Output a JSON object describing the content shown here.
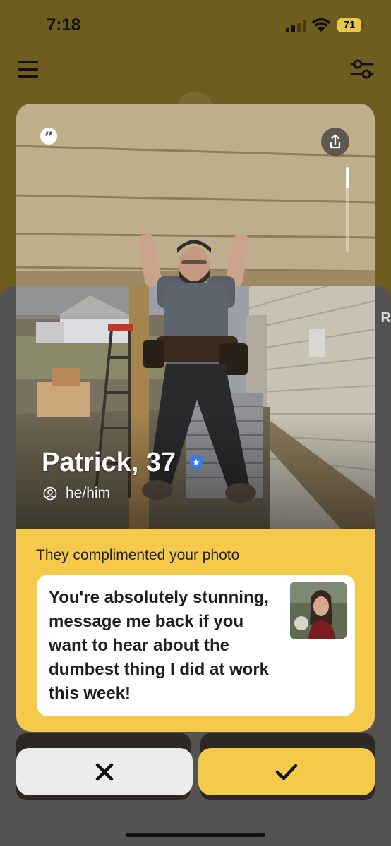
{
  "status_bar": {
    "time": "7:18",
    "battery": "71"
  },
  "nav": {
    "menu_icon": "menu-icon",
    "filter_icon": "filter-icon"
  },
  "profile": {
    "name_age": "Patrick, 37",
    "pronouns": "he/him",
    "verified": true,
    "photo_progress": 0.25
  },
  "compliment": {
    "title": "They complimented your photo",
    "message": "You're absolutely stunning, message me back if you want to hear about the dumbest thing I did at work this week!"
  },
  "peek_letter": "R",
  "colors": {
    "accent": "#f5c94a",
    "verified_blue": "#3a7be8",
    "backdrop": "#6f5d1f"
  },
  "actions": {
    "pass_icon": "close-icon",
    "like_icon": "check-icon"
  }
}
